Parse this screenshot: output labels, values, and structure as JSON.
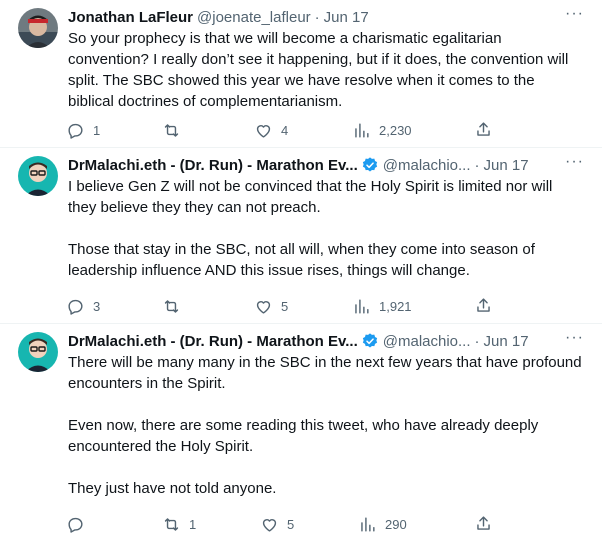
{
  "tweets": [
    {
      "author_name": "Jonathan LaFleur",
      "handle": "@joenate_lafleur",
      "separator": "·",
      "time": "Jun 17",
      "more": "···",
      "paragraphs": [
        "So your prophecy is that we will become a charismatic egalitarian convention? I really don’t see it happening, but if it does, the convention will split. The SBC showed this year we have resolve when it comes to the biblical doctrines of complementarianism."
      ],
      "replies": "1",
      "retweets": "",
      "likes": "4",
      "views": "2,230"
    },
    {
      "author_name": "DrMalachi.eth - (Dr. Run) - Marathon Ev...",
      "handle": "@malachio...",
      "separator": "·",
      "time": "Jun 17",
      "more": "···",
      "paragraphs": [
        "I believe Gen Z will not be convinced that the Holy Spirit is limited nor will they believe they they can not preach.",
        "Those that stay in the SBC, not all will, when they come into season of leadership influence AND this issue rises, things will change."
      ],
      "replies": "3",
      "retweets": "",
      "likes": "5",
      "views": "1,921"
    },
    {
      "author_name": "DrMalachi.eth - (Dr. Run) - Marathon Ev...",
      "handle": "@malachio...",
      "separator": "·",
      "time": "Jun 17",
      "more": "···",
      "paragraphs": [
        "There will be many many in the SBC in the next few years that have profound encounters in the Spirit.",
        "Even now, there are some reading this tweet, who have already deeply encountered the Holy Spirit.",
        "They just have not told anyone."
      ],
      "replies": "",
      "retweets": "1",
      "likes": "5",
      "views": "290"
    }
  ],
  "icons": {
    "reply": "reply-icon",
    "retweet": "retweet-icon",
    "like": "heart-icon",
    "views": "views-icon",
    "share": "share-icon",
    "verified": "verified-badge-icon"
  },
  "colors": {
    "text": "#0f1419",
    "muted": "#536471",
    "verified": "#1d9bf0",
    "divider": "#eff3f4"
  }
}
